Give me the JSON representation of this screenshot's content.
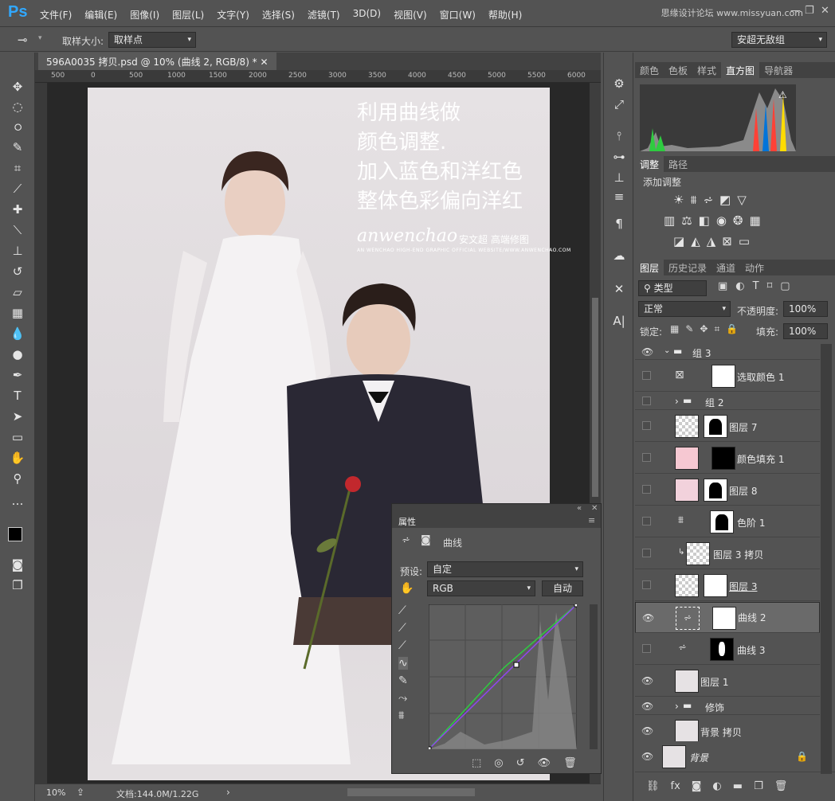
{
  "app": {
    "logo": "Ps",
    "watermark": "思缘设计论坛 www.missyuan.com",
    "window_controls": [
      "—",
      "❐",
      "✕"
    ]
  },
  "menu": [
    "文件(F)",
    "编辑(E)",
    "图像(I)",
    "图层(L)",
    "文字(Y)",
    "选择(S)",
    "滤镜(T)",
    "3D(D)",
    "视图(V)",
    "窗口(W)",
    "帮助(H)"
  ],
  "options": {
    "sample_label": "取样大小:",
    "sample_value": "取样点",
    "workspace": "安超无敌组"
  },
  "document": {
    "tab": "596A0035 拷贝.psd @ 10% (曲线 2, RGB/8) *",
    "ruler_marks": [
      "500",
      "0",
      "500",
      "1000",
      "1500",
      "2000",
      "2500",
      "3000",
      "3500",
      "4000",
      "4500",
      "5000",
      "5500",
      "6000"
    ]
  },
  "photo_text": {
    "lines": "利用曲线做\n颜色调整.\n加入蓝色和洋红色\n整体色彩偏向洋红",
    "brand": "anwenchao",
    "brand_cn": "安文超 高端修图",
    "brand_sub": "AN WENCHAO HIGH-END GRAPHIC OFFICIAL WEBSITE/WWW.ANWENCHAO.COM"
  },
  "status": {
    "zoom": "10%",
    "doc": "文档:144.0M/1.22G"
  },
  "top_panel": {
    "tabs": [
      "颜色",
      "色板",
      "样式",
      "直方图",
      "导航器"
    ],
    "active": 3
  },
  "adjust_panel": {
    "tabs": [
      "调整",
      "路径"
    ],
    "title": "添加调整"
  },
  "layers_panel": {
    "tabs": [
      "图层",
      "历史记录",
      "通道",
      "动作"
    ],
    "filter": "类型",
    "blend": "正常",
    "opacity_label": "不透明度:",
    "opacity": "100%",
    "lock_label": "锁定:",
    "fill_label": "填充:",
    "fill": "100%"
  },
  "layers": [
    {
      "name": "组 3",
      "type": "group",
      "eye": true
    },
    {
      "name": "选取颜色 1",
      "type": "adj",
      "eye": false
    },
    {
      "name": "组 2",
      "type": "group",
      "eye": false
    },
    {
      "name": "图层 7",
      "type": "layer",
      "eye": false
    },
    {
      "name": "颜色填充 1",
      "type": "fill",
      "eye": false
    },
    {
      "name": "图层 8",
      "type": "layer",
      "eye": false
    },
    {
      "name": "色阶 1",
      "type": "adj",
      "eye": false
    },
    {
      "name": "图层 3 拷贝",
      "type": "layer",
      "eye": false
    },
    {
      "name": "图层 3",
      "type": "layer",
      "eye": false
    },
    {
      "name": "曲线 2",
      "type": "adj",
      "eye": true
    },
    {
      "name": "曲线 3",
      "type": "adj",
      "eye": false
    },
    {
      "name": "图层 1",
      "type": "layer",
      "eye": true
    },
    {
      "name": "修饰",
      "type": "group",
      "eye": true
    },
    {
      "name": "背景 拷贝",
      "type": "layer",
      "eye": true
    },
    {
      "name": "背景",
      "type": "layer",
      "eye": true
    }
  ],
  "properties": {
    "title": "属性",
    "panel": "曲线",
    "preset_label": "预设:",
    "preset": "自定",
    "channel": "RGB",
    "auto": "自动"
  }
}
